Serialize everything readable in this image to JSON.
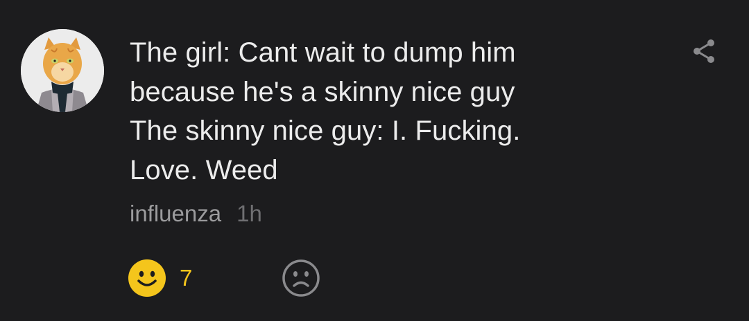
{
  "post": {
    "avatar_icon": "cat-portrait-avatar",
    "text": "The girl: Cant wait to dump him\nbecause he's a skinny nice guy\nThe skinny nice guy: I. Fucking.\nLove. Weed",
    "author": "influenza",
    "time": "1h"
  },
  "actions": {
    "share_icon": "share-icon",
    "like_icon": "smiley-face-icon",
    "like_count": "7",
    "dislike_icon": "sad-face-icon"
  },
  "colors": {
    "background": "#1c1c1e",
    "text": "#ececec",
    "author": "#9b9b9d",
    "like_accent": "#f4c51c",
    "icon_gray": "#8a8a8d"
  }
}
